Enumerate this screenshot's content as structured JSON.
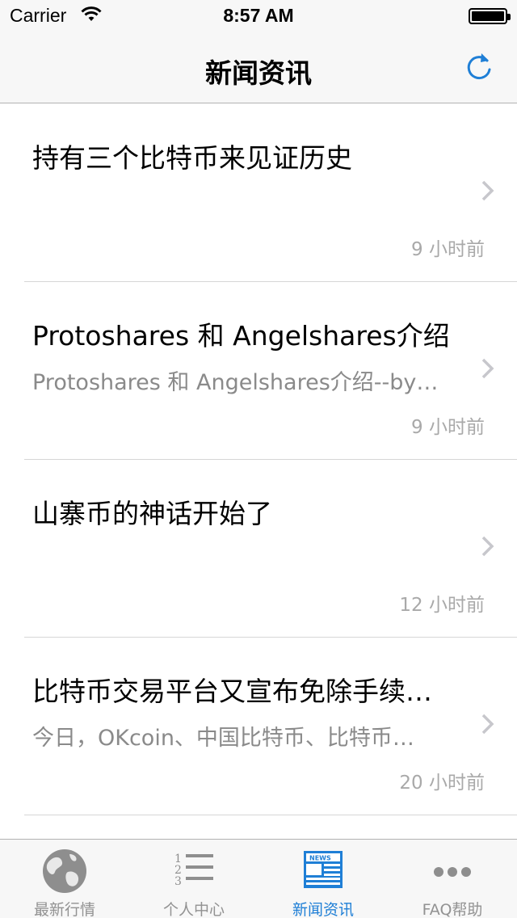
{
  "status_bar": {
    "carrier": "Carrier",
    "time": "8:57 AM"
  },
  "nav": {
    "title": "新闻资讯",
    "refresh_icon": "refresh-icon",
    "accent_color": "#1f7fd6"
  },
  "news": [
    {
      "title": "持有三个比特币来见证历史",
      "summary": "",
      "time": "9 小时前"
    },
    {
      "title": "Protoshares 和 Angelshares介绍",
      "summary": "Protoshares 和 Angelshares介绍--by…",
      "time": "9 小时前"
    },
    {
      "title": "山寨币的神话开始了",
      "summary": "",
      "time": "12 小时前"
    },
    {
      "title": "比特币交易平台又宣布免除手续…",
      "summary": "今日，OKcoin、中国比特币、比特币…",
      "time": "20 小时前"
    }
  ],
  "tabs": [
    {
      "label": "最新行情",
      "icon": "globe-icon",
      "active": false
    },
    {
      "label": "个人中心",
      "icon": "numbered-list-icon",
      "active": false
    },
    {
      "label": "新闻资讯",
      "icon": "newspaper-icon",
      "active": true
    },
    {
      "label": "FAQ帮助",
      "icon": "more-dots-icon",
      "active": false
    }
  ]
}
